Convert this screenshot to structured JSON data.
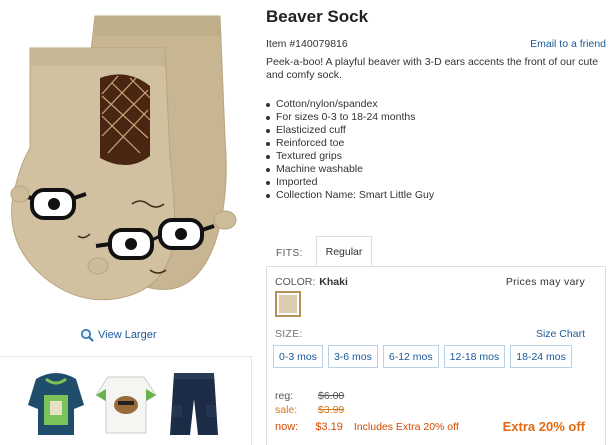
{
  "product": {
    "title": "Beaver Sock",
    "item_number": "Item #140079816",
    "email_link": "Email to a friend",
    "description": "Peek-a-boo! A playful beaver with 3-D ears accents the front of our cute and comfy sock.",
    "features": [
      "Cotton/nylon/spandex",
      "For sizes 0-3 to 18-24 months",
      "Elasticized cuff",
      "Reinforced toe",
      "Textured grips",
      "Machine washable",
      "Imported",
      "Collection Name: Smart Little Guy"
    ]
  },
  "gallery": {
    "view_larger": "View Larger"
  },
  "fits": {
    "label": "FITS:",
    "tab": "Regular"
  },
  "options": {
    "color_label": "COLOR:",
    "color_value": "Khaki",
    "swatch_color": "#ddcdb0",
    "prices_vary": "Prices may vary",
    "size_label": "SIZE:",
    "size_chart": "Size Chart",
    "sizes": [
      "0-3 mos",
      "3-6 mos",
      "6-12 mos",
      "12-18 mos",
      "18-24 mos"
    ]
  },
  "pricing": {
    "reg_label": "reg:",
    "reg_price": "$6.00",
    "sale_label": "sale:",
    "sale_price": "$3.99",
    "now_label": "now:",
    "now_price": "$3.19",
    "includes": "Includes Extra 20% off",
    "extra_badge": "Extra 20% off"
  },
  "colors": {
    "link": "#1a5a9a",
    "sale": "#d07818",
    "now": "#d44a00",
    "extra": "#e36a10"
  }
}
